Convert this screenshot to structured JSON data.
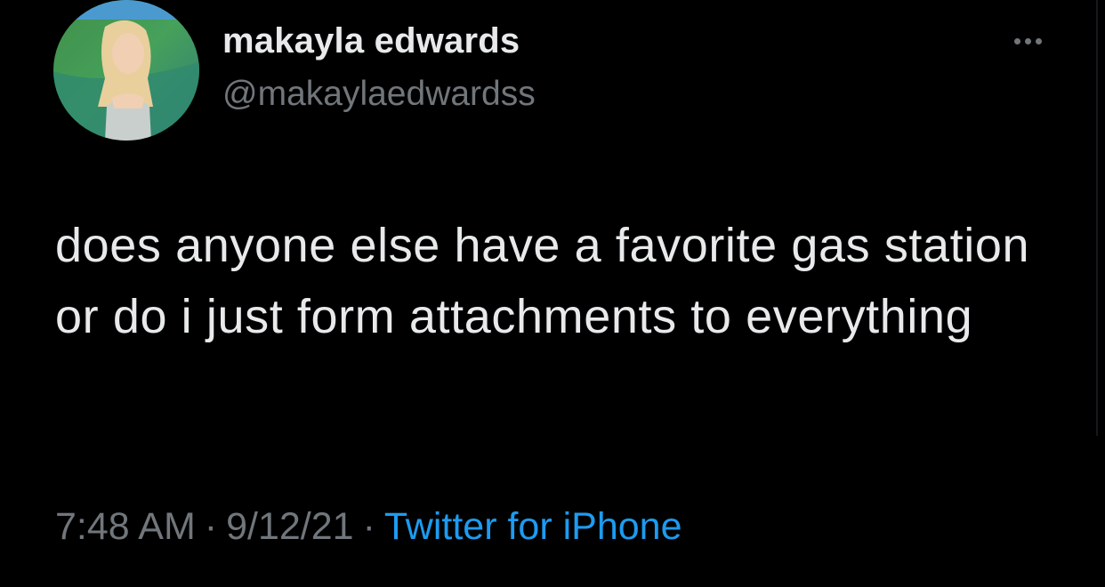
{
  "author": {
    "display_name": "makayla edwards",
    "handle": "@makaylaedwardss"
  },
  "tweet": {
    "text": "does anyone else have a favorite gas station or do i just form attachments to everything",
    "time": "7:48 AM",
    "separator": "·",
    "date": "9/12/21",
    "source": "Twitter for iPhone"
  },
  "icons": {
    "more": "more-horizontal-icon"
  },
  "colors": {
    "background": "#000000",
    "text_primary": "#e7e9ea",
    "text_secondary": "#71767b",
    "link": "#1d9bf0"
  }
}
